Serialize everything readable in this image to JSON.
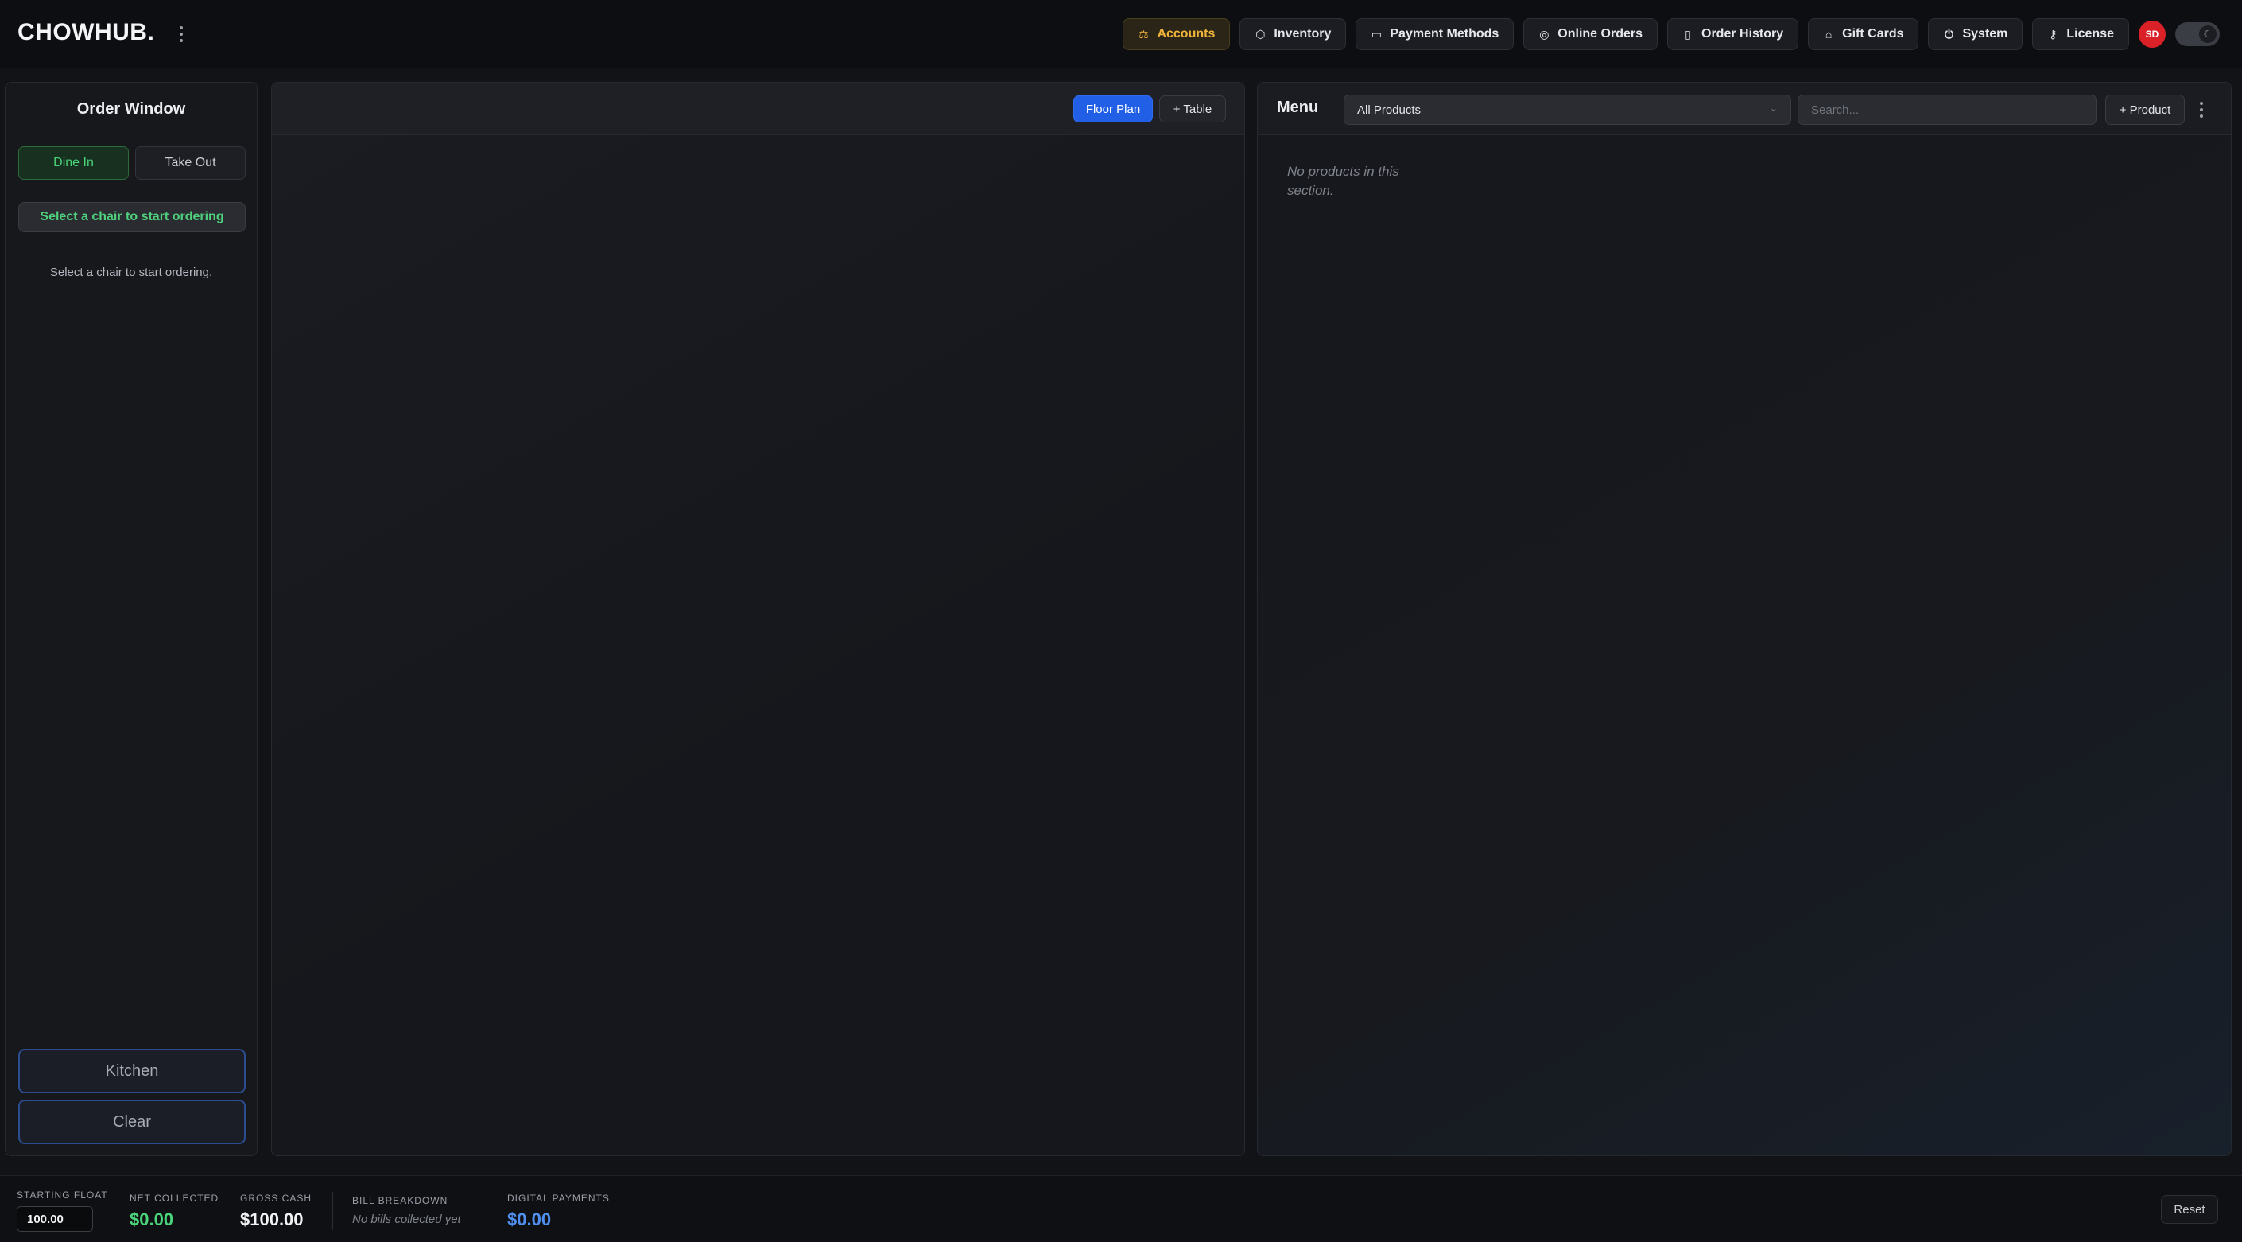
{
  "app": {
    "logo": "CHOWHUB.",
    "logo_menu_icon": "kebab-icon"
  },
  "nav": {
    "items": [
      {
        "label": "Accounts",
        "icon": "accounts-icon",
        "glyph": "⚖",
        "active": true
      },
      {
        "label": "Inventory",
        "icon": "box-icon",
        "glyph": "⬡",
        "active": false
      },
      {
        "label": "Payment Methods",
        "icon": "card-icon",
        "glyph": "▭",
        "active": false
      },
      {
        "label": "Online Orders",
        "icon": "globe-icon",
        "glyph": "◎",
        "active": false
      },
      {
        "label": "Order History",
        "icon": "clipboard-icon",
        "glyph": "▯",
        "active": false
      },
      {
        "label": "Gift Cards",
        "icon": "gift-icon",
        "glyph": "⌂",
        "active": false
      },
      {
        "label": "System",
        "icon": "power-icon",
        "glyph": "⏻",
        "active": false
      },
      {
        "label": "License",
        "icon": "key-icon",
        "glyph": "⚷",
        "active": false
      }
    ],
    "avatar_initials": "SD",
    "theme_toggle_icon": "moon-icon"
  },
  "order": {
    "title": "Order Window",
    "dine_in": "Dine In",
    "take_out": "Take Out",
    "chair_hint": "Select a chair to start ordering",
    "empty_text": "Select a chair to start ordering.",
    "kitchen": "Kitchen",
    "clear": "Clear"
  },
  "floor": {
    "floor_plan": "Floor Plan",
    "add_table": "+ Table"
  },
  "menu": {
    "title": "Menu",
    "category_selected": "All Products",
    "search_placeholder": "Search...",
    "add_product": "+ Product",
    "empty_text": "No products in this section."
  },
  "footer": {
    "starting_float_label": "STARTING FLOAT",
    "starting_float_value": "100.00",
    "net_collected_label": "NET COLLECTED",
    "net_collected_value": "$0.00",
    "gross_cash_label": "GROSS CASH",
    "gross_cash_value": "$100.00",
    "bill_breakdown_label": "BILL BREAKDOWN",
    "bill_breakdown_note": "No bills collected yet",
    "digital_payments_label": "DIGITAL PAYMENTS",
    "digital_payments_value": "$0.00",
    "reset": "Reset"
  },
  "colors": {
    "accent_active": "#f0b43a",
    "primary_blue": "#2160e6",
    "green": "#4ad47a",
    "blue_value": "#4f8ff0",
    "avatar_red": "#d92127"
  }
}
